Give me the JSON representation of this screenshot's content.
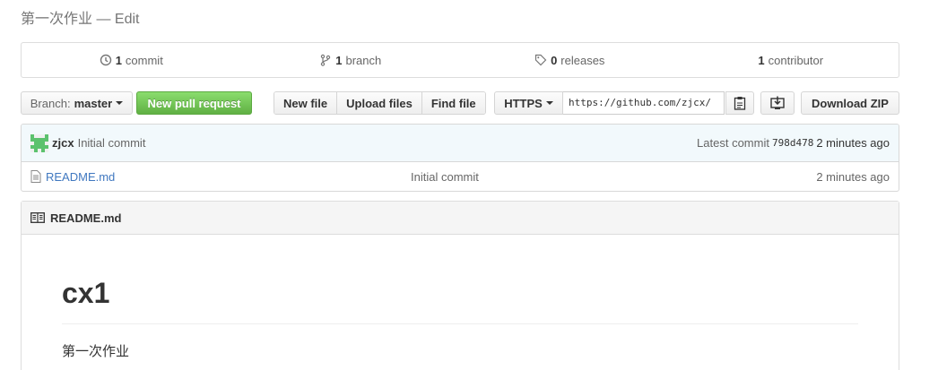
{
  "repo": {
    "description": "第一次作业 — Edit"
  },
  "summary": {
    "commits": {
      "count": "1",
      "label": "commit"
    },
    "branches": {
      "count": "1",
      "label": "branch"
    },
    "releases": {
      "count": "0",
      "label": "releases"
    },
    "contributors": {
      "count": "1",
      "label": "contributor"
    }
  },
  "toolbar": {
    "branch_prefix": "Branch:",
    "branch_name": "master",
    "pull_request_label": "New pull request",
    "new_file_label": "New file",
    "upload_files_label": "Upload files",
    "find_file_label": "Find file",
    "clone_protocol": "HTTPS",
    "clone_url": "https://github.com/zjcx/",
    "download_zip_label": "Download ZIP"
  },
  "latest_commit": {
    "author": "zjcx",
    "message": "Initial commit",
    "latest_label": "Latest commit",
    "sha": "798d478",
    "age": "2 minutes ago"
  },
  "files": [
    {
      "name": "README.md",
      "message": "Initial commit",
      "age": "2 minutes ago"
    }
  ],
  "readme": {
    "filename": "README.md",
    "heading": "cx1",
    "body": "第一次作业"
  },
  "colors": {
    "link": "#4078c0",
    "green_button": "#60b044",
    "commit_bar_bg": "#f2f9fc"
  },
  "icons": [
    "history-icon",
    "branch-icon",
    "tag-icon",
    "clipboard-icon",
    "desktop-download-icon",
    "file-icon",
    "book-icon",
    "avatar-identicon"
  ]
}
